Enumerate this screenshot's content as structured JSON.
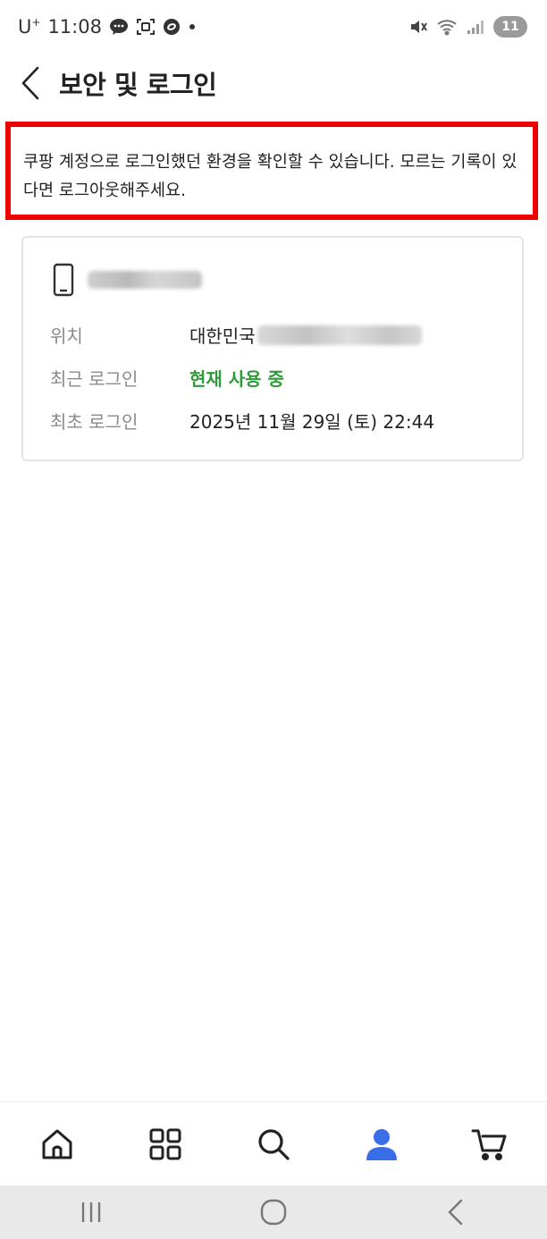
{
  "status_bar": {
    "carrier": "U",
    "carrier_sup": "+",
    "time": "11:08",
    "battery": "11",
    "icons": [
      "chat-bubble-icon",
      "scan-icon",
      "sync-icon",
      "dot-icon",
      "mute-icon",
      "wifi-icon",
      "signal-icon",
      "battery-icon"
    ]
  },
  "header": {
    "back_icon": "back-chevron-icon",
    "title": "보안 및 로그인"
  },
  "notice": {
    "text": "쿠팡 계정으로 로그인했던 환경을 확인할 수 있습니다. 모르는 기록이 있다면 로그아웃해주세요.",
    "border_color": "#ee0000"
  },
  "device": {
    "icon": "smartphone-icon",
    "location_label": "위치",
    "location_value": "대한민국",
    "recent_login_label": "최근 로그인",
    "recent_login_value": "현재 사용 중",
    "recent_login_color": "#2e9a3a",
    "first_login_label": "최초 로그인",
    "first_login_value": "2025년 11월 29일 (토) 22:44"
  },
  "bottom_nav": {
    "items": [
      {
        "icon": "home-icon",
        "active": false
      },
      {
        "icon": "category-grid-icon",
        "active": false
      },
      {
        "icon": "search-icon",
        "active": false
      },
      {
        "icon": "my-profile-icon",
        "active": true
      },
      {
        "icon": "cart-icon",
        "active": false
      }
    ],
    "active_color": "#3a6ee8"
  },
  "system_nav": {
    "items": [
      "recent-apps-icon",
      "home-circle-icon",
      "system-back-icon"
    ]
  }
}
